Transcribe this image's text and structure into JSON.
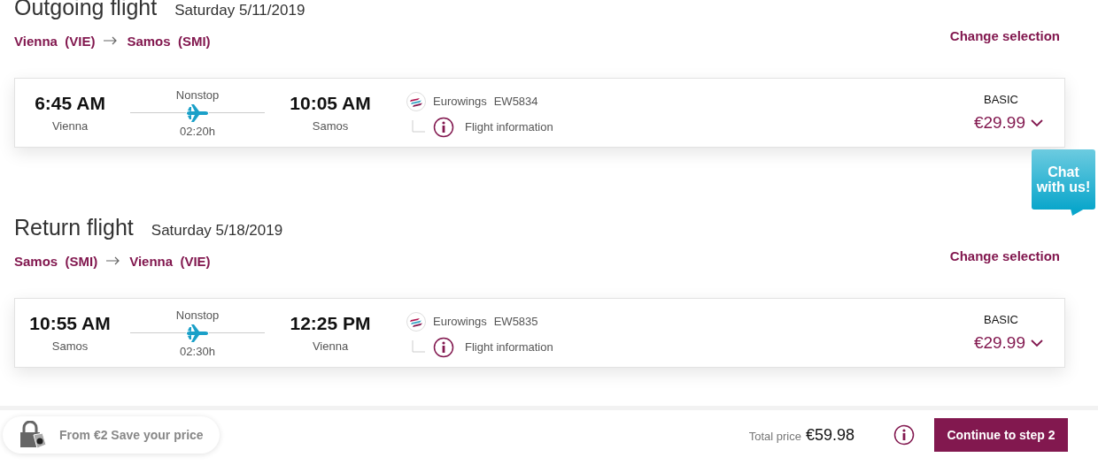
{
  "flights": [
    {
      "title": "Outgoing flight",
      "date": "Saturday 5/11/2019",
      "origin": "Vienna  (VIE)",
      "destination": "Samos  (SMI)",
      "change_label": "Change selection",
      "departure_time": "6:45 AM",
      "departure_city": "Vienna",
      "stops": "Nonstop",
      "duration": "02:20h",
      "arrival_time": "10:05 AM",
      "arrival_city": "Samos",
      "airline": "Eurowings",
      "flight_number": "EW5834",
      "info_label": "Flight information",
      "fare": "BASIC",
      "price": "€29.99"
    },
    {
      "title": "Return flight",
      "date": "Saturday 5/18/2019",
      "origin": "Samos  (SMI)",
      "destination": "Vienna  (VIE)",
      "change_label": "Change selection",
      "departure_time": "10:55 AM",
      "departure_city": "Samos",
      "stops": "Nonstop",
      "duration": "02:30h",
      "arrival_time": "12:25 PM",
      "arrival_city": "Vienna",
      "airline": "Eurowings",
      "flight_number": "EW5835",
      "info_label": "Flight information",
      "fare": "BASIC",
      "price": "€29.99"
    }
  ],
  "chat": {
    "label": "Chat with us!"
  },
  "footer": {
    "save_price": "From €2 Save your price",
    "total_label": "Total price",
    "total": "€59.98",
    "continue": "Continue to step 2"
  }
}
